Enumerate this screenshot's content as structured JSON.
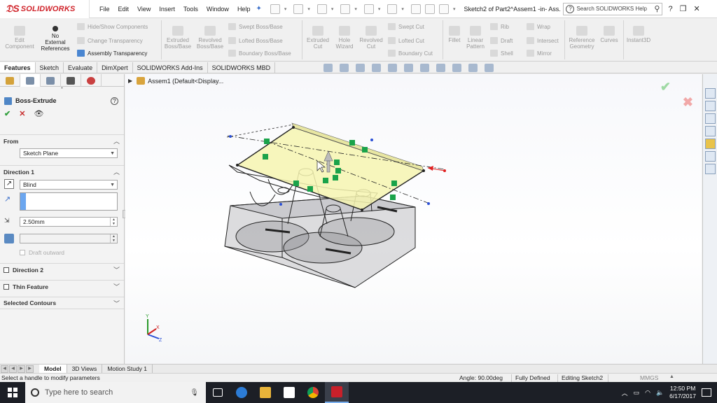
{
  "app": {
    "brand": "SOLIDWORKS",
    "menus": [
      "File",
      "Edit",
      "View",
      "Insert",
      "Tools",
      "Window",
      "Help"
    ],
    "document_title": "Sketch2 of Part2^Assem1 -in- Ass...",
    "search_placeholder": "Search SOLIDWORKS Help"
  },
  "ribbon": {
    "edit_component": "Edit\nComponent",
    "no_external_references": "No\nExternal\nReferences",
    "hide_show_components": "Hide/Show Components",
    "change_transparency": "Change Transparency",
    "assembly_transparency": "Assembly Transparency",
    "extruded_boss": "Extruded\nBoss/Base",
    "revolved_boss": "Revolved\nBoss/Base",
    "swept_boss": "Swept Boss/Base",
    "lofted_boss": "Lofted Boss/Base",
    "boundary_boss": "Boundary Boss/Base",
    "extruded_cut": "Extruded\nCut",
    "hole_wizard": "Hole\nWizard",
    "revolved_cut": "Revolved\nCut",
    "swept_cut": "Swept Cut",
    "lofted_cut": "Lofted Cut",
    "boundary_cut": "Boundary Cut",
    "fillet": "Fillet",
    "linear_pattern": "Linear\nPattern",
    "rib": "Rib",
    "draft": "Draft",
    "shell": "Shell",
    "wrap": "Wrap",
    "intersect": "Intersect",
    "mirror": "Mirror",
    "reference_geometry": "Reference\nGeometry",
    "curves": "Curves",
    "instant3d": "Instant3D"
  },
  "tabs": [
    "Features",
    "Sketch",
    "Evaluate",
    "DimXpert",
    "SOLIDWORKS Add-Ins",
    "SOLIDWORKS MBD"
  ],
  "property_manager": {
    "title": "Boss-Extrude",
    "from_label": "From",
    "from_value": "Sketch Plane",
    "direction1_label": "Direction 1",
    "end_condition": "Blind",
    "depth": "2.50mm",
    "draft_outward": "Draft outward",
    "direction2_label": "Direction 2",
    "thin_feature_label": "Thin Feature",
    "selected_contours_label": "Selected Contours"
  },
  "tree": {
    "root": "Assem1  (Default<Display..."
  },
  "triad": {
    "x": "X",
    "y": "Y",
    "z": "Z"
  },
  "bottom_tabs": [
    "Model",
    "3D Views",
    "Motion Study 1"
  ],
  "status": {
    "message": "Select a handle to modify parameters",
    "angle": "Angle: 90.00deg",
    "definition": "Fully Defined",
    "editing": "Editing Sketch2",
    "units": "MMGS"
  },
  "taskbar": {
    "search_placeholder": "Type here to search",
    "time": "12:50 PM",
    "date": "6/17/2017"
  },
  "colors": {
    "brand_red": "#d0232a",
    "sketch_fill": "#f6f4b0",
    "relation_green": "#1aa34a"
  }
}
